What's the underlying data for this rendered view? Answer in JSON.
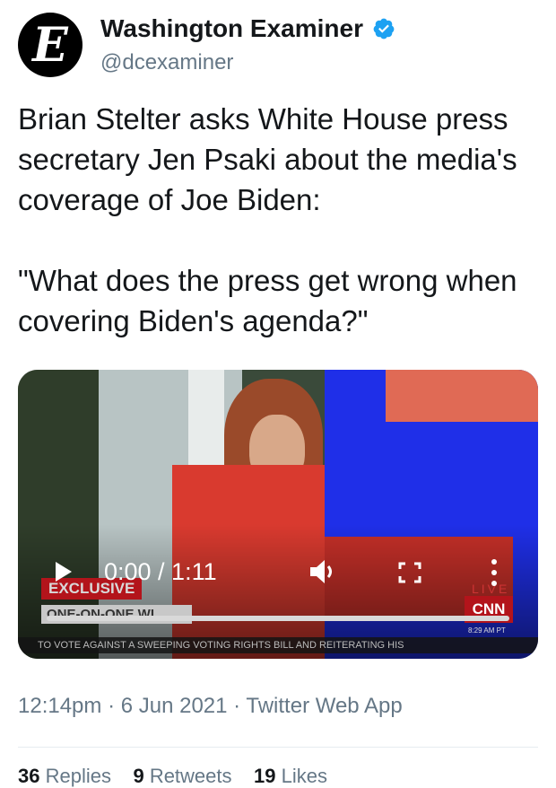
{
  "account": {
    "display_name": "Washington Examiner",
    "handle": "@dcexaminer",
    "avatar_letter": "E",
    "verified": true
  },
  "tweet": {
    "text": "Brian Stelter asks White House press secretary Jen Psaki about the media's coverage of Joe Biden:\n\n\"What does the press get wrong when covering Biden's agenda?\""
  },
  "video": {
    "time_display": "0:00 / 1:11",
    "progress": 0,
    "overlay": {
      "exclusive_label": "EXCLUSIVE",
      "segment_label": "ONE-ON-ONE WI",
      "live_label": "LIVE",
      "network_logo": "CNN",
      "clock": "8:29 AM PT",
      "ticker": "TO VOTE AGAINST A SWEEPING VOTING RIGHTS BILL AND REITERATING HIS"
    }
  },
  "meta": {
    "text": "12:14pm · 6 Jun 2021 · Twitter Web App"
  },
  "stats": {
    "retweets_count": "36",
    "retweets_label": "Replies",
    "quotes_count": "9",
    "quotes_label": "Retweets",
    "likes_count": "19",
    "likes_label": "Likes"
  },
  "colors": {
    "verified": "#1da1f2",
    "secondary_text": "#657786",
    "primary_text": "#14171a"
  }
}
